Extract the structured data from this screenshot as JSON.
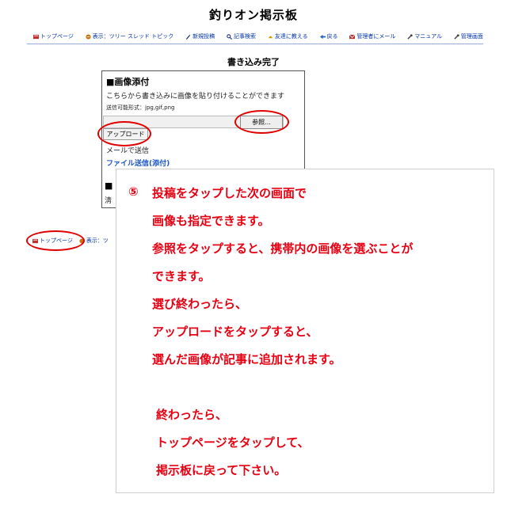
{
  "site": {
    "title": "釣りオン掲示板"
  },
  "nav": {
    "items": [
      {
        "label": "トップページ",
        "icon": "book-icon",
        "color": "#c03030"
      },
      {
        "label": "表示：ツリー スレッド トピック",
        "icon": "arrows-icon",
        "color": "#d07010"
      },
      {
        "label": "新規投稿",
        "icon": "pencil-icon",
        "color": "#203080"
      },
      {
        "label": "記事検索",
        "icon": "search-icon",
        "color": "#203080"
      },
      {
        "label": "友達に教える",
        "icon": "bell-icon",
        "color": "#d0a000"
      },
      {
        "label": "戻る",
        "icon": "back-icon",
        "color": "#2060c0"
      },
      {
        "label": "管理者にメール",
        "icon": "mail-icon",
        "color": "#c03030"
      },
      {
        "label": "マニュアル",
        "icon": "wrench-icon",
        "color": "#404040"
      },
      {
        "label": "管理画面",
        "icon": "wrench-icon",
        "color": "#404040"
      }
    ]
  },
  "page": {
    "complete_title": "書き込み完了"
  },
  "attach": {
    "heading": "■画像添付",
    "description": "こちらから書き込みに画像を貼り付けることができます",
    "formats": "送信可能形式：jpg,gif,png",
    "browse_label": "参照...",
    "upload_label": "アップロード",
    "mail_label": "メールで送信",
    "file_link": "ファイル送信(添付)",
    "hidden_heading": "■",
    "hidden_text": "淸"
  },
  "bottom_nav": {
    "top_label": "トップページ",
    "view_label": "表示：ツ"
  },
  "callout": {
    "number": "⑤",
    "lines": [
      "投稿をタップした次の画面で",
      "画像も指定できます。",
      "参照をタップすると、携帯内の画像を選ぶことが",
      "できます。",
      "選び終わったら、",
      "アップロードをタップすると、",
      "選んだ画像が記事に追加されます。",
      "終わったら、",
      "トップページをタップして、",
      "掲示板に戻って下さい。"
    ]
  },
  "colors": {
    "highlight": "#e00000",
    "callout_text": "#e60012",
    "link": "#1a55c8"
  }
}
